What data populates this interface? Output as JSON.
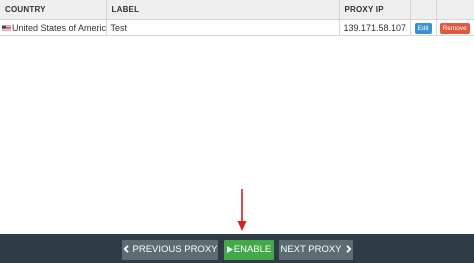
{
  "table": {
    "headers": {
      "country": "COUNTRY",
      "label": "LABEL",
      "proxy_ip": "PROXY IP"
    },
    "rows": [
      {
        "country": "United States of America",
        "label": "Test",
        "proxy_ip": "139.171.58.107",
        "edit_label": "Edit",
        "remove_label": "Remove"
      }
    ]
  },
  "footer": {
    "previous_label": "PREVIOUS PROXY",
    "enable_label": "ENABLE",
    "next_label": "NEXT PROXY"
  },
  "colors": {
    "edit_button": "#3a91d1",
    "remove_button": "#e2583e",
    "enable_button": "#41a947",
    "nav_button": "#5d6b73",
    "footer_bar": "#2f3c45",
    "annotation_arrow": "#d62020"
  },
  "icons": {
    "flag": "us-flag-icon",
    "previous": "chevron-left-icon",
    "enable": "play-icon",
    "next": "chevron-right-icon",
    "annotation": "arrow-down-icon"
  }
}
